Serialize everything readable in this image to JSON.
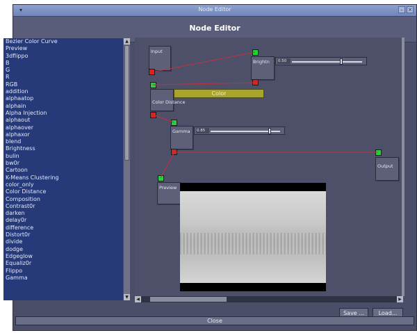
{
  "window": {
    "title": "Node Editor",
    "header": "Node Editor"
  },
  "node_list": {
    "items": [
      "Bezier Color Curve",
      "Preview",
      "3dflippo",
      "B",
      "G",
      "R",
      "RGB",
      "addition",
      "alphaatop",
      "alphain",
      "Alpha Injection",
      "alphaout",
      "alphaover",
      "alphaxor",
      "blend",
      "Brightness",
      "bulin",
      "bw0r",
      "Cartoon",
      "K-Means Clustering",
      "color_only",
      "Color Distance",
      "Composition",
      "Contrast0r",
      "darken",
      "delay0r",
      "difference",
      "Distort0r",
      "divide",
      "dodge",
      "Edgeglow",
      "Equaliz0r",
      "Flippo",
      "Gamma"
    ]
  },
  "graph": {
    "nodes": {
      "input": {
        "label": "Input"
      },
      "brightness": {
        "label": "Brightn",
        "value": "0.50",
        "level": 0.7
      },
      "color_distance": {
        "label": "Color Distance",
        "color_label": "Color"
      },
      "gamma": {
        "label": "Gamma",
        "value": "0.85",
        "level": 0.85
      },
      "output": {
        "label": "Output"
      },
      "preview": {
        "label": "Preview"
      }
    }
  },
  "buttons": {
    "save": "Save ...",
    "load": "Load...",
    "close": "Close"
  },
  "colors": {
    "window_bg": "#4b4e68",
    "list_bg": "#263a7a",
    "input_port": "#22d43a",
    "output_port": "#d62424",
    "wire": "#c0323a",
    "color_bar": "#a9a52a"
  }
}
